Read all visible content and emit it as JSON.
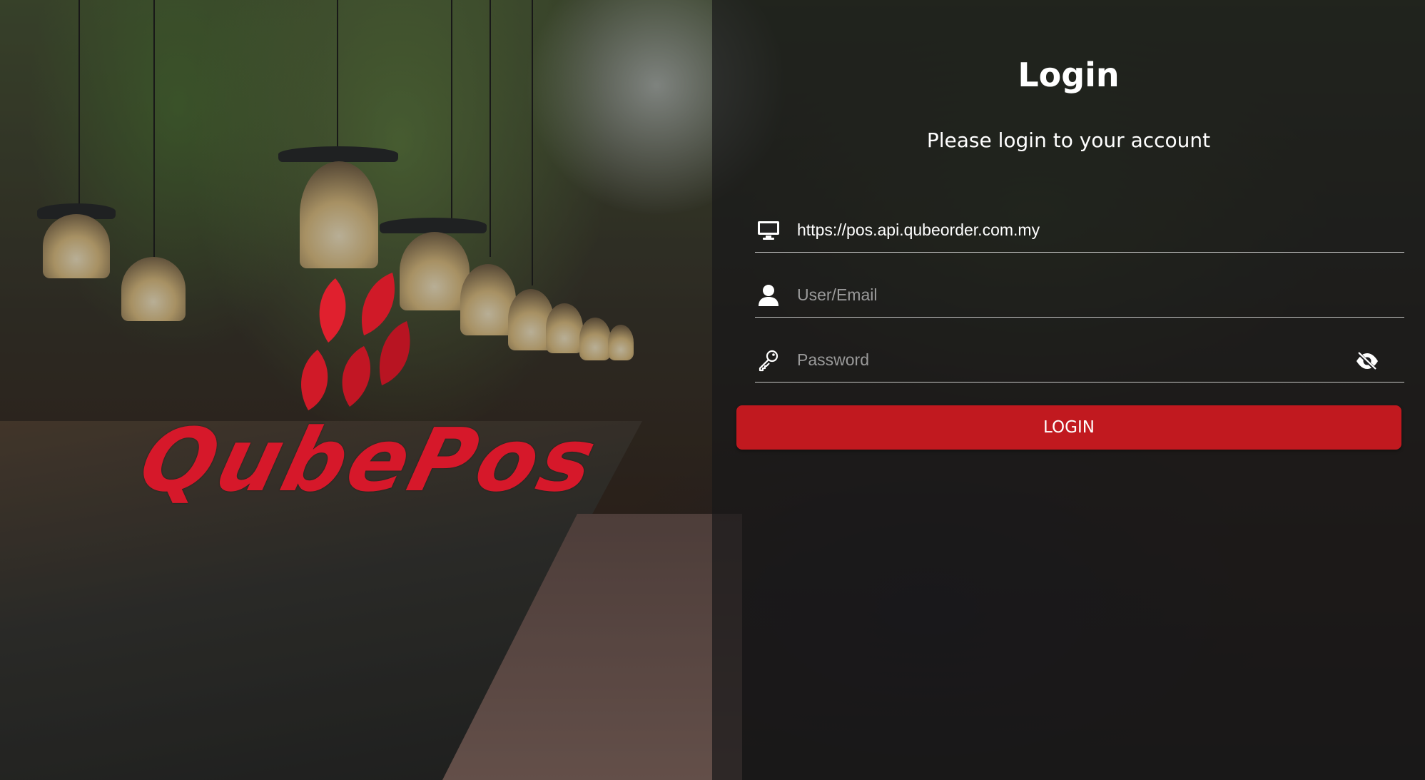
{
  "page": {
    "title": "Login",
    "subtitle": "Please login to your account"
  },
  "brand": {
    "logo_text": "QubePos",
    "color": "#d6182a"
  },
  "form": {
    "server": {
      "icon": "monitor-icon",
      "value": "https://pos.api.qubeorder.com.my"
    },
    "user": {
      "icon": "user-icon",
      "placeholder": "User/Email"
    },
    "password": {
      "icon": "key-icon",
      "placeholder": "Password",
      "toggle_icon": "eye-off-icon"
    },
    "login_label": "LOGIN"
  },
  "colors": {
    "button": "#c1191f",
    "overlay": "rgba(20,20,22,0.78)"
  }
}
